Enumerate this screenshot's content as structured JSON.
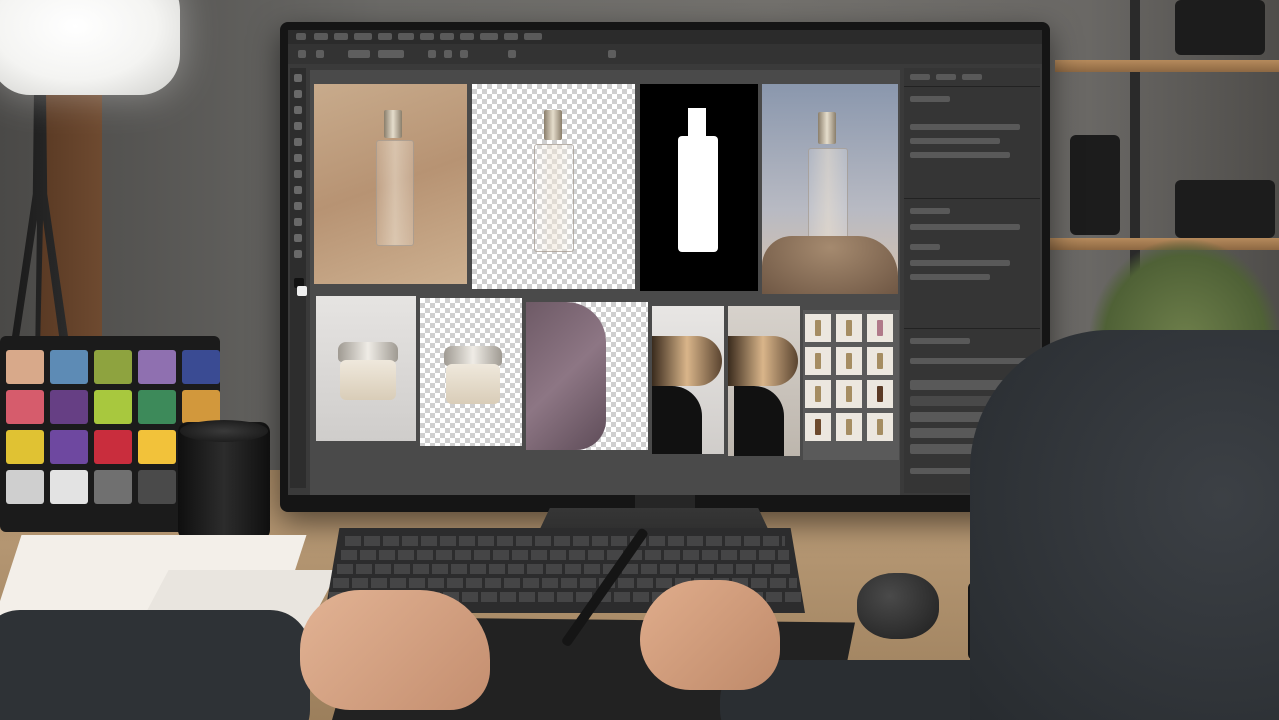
{
  "scene": {
    "description_alt": "",
    "palette": {
      "wall": "#6b6a67",
      "desk": "#b49672",
      "screen_bg": "#3a3a3a",
      "panel_bg": "#353535"
    }
  },
  "color_checker": {
    "patches": [
      "#d8a98a",
      "#5d8bb5",
      "#8ea33f",
      "#8f70b0",
      "#3a4b93",
      "#d65c6c",
      "#663f84",
      "#a8c83e",
      "#3d8a5a",
      "#d2983c",
      "#e0c233",
      "#6e48a0",
      "#c92d3d",
      "#f2c23a",
      "#9d9d9d",
      "#cfcfcf",
      "#e3e3e3",
      "#707070",
      "#4a4a4a",
      "#2f8a6e"
    ]
  },
  "photoshop": {
    "icons": [
      "move-icon",
      "marquee-icon",
      "lasso-icon",
      "crop-icon",
      "eyedropper-icon",
      "brush-icon",
      "eraser-icon",
      "gradient-icon",
      "pen-tool-icon",
      "type-icon",
      "hand-icon",
      "zoom-icon"
    ]
  }
}
